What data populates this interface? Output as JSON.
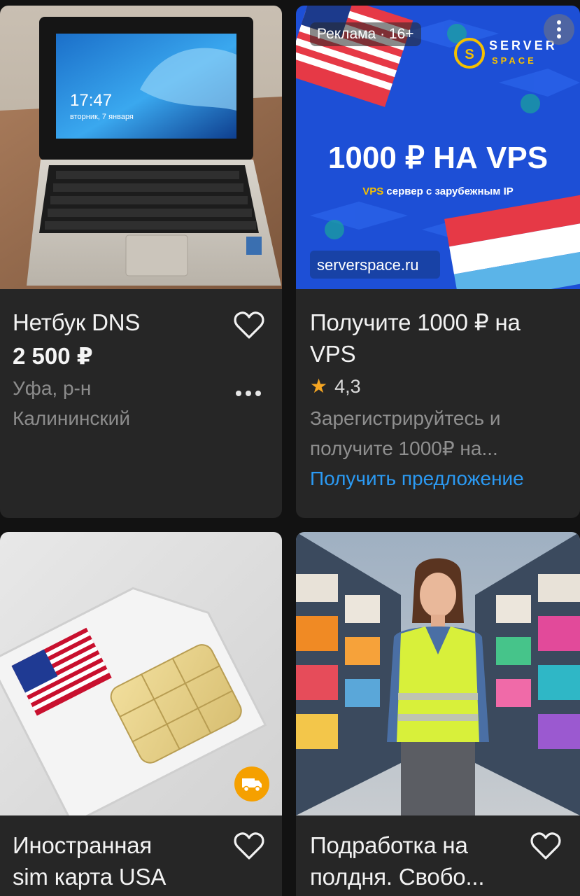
{
  "cards": {
    "netbook": {
      "title": "Нетбук DNS",
      "price": "2 500 ₽",
      "location_line1": "Уфа, р-н",
      "location_line2": "Калининский",
      "screen_time": "17:47",
      "screen_date": "вторник, 7 января",
      "image_icon": "laptop-photo"
    },
    "ad": {
      "badge": "Реклама · 16+",
      "brand_line1": "SERVER",
      "brand_line2": "SPACE",
      "headline": "1000 ₽ НА VPS",
      "sub_highlight": "VPS",
      "sub_rest": " сервер с зарубежным IP",
      "domain": "serverspace.ru",
      "title_line1": "Получите 1000 ₽ на",
      "title_line2": "VPS",
      "rating": "4,3",
      "desc_line1": "Зарегистрируйтесь и",
      "desc_line2": "получите 1000₽ на...",
      "cta": "Получить предложение",
      "accent_color": "#2b9af3",
      "banner_color": "#1d4fd6"
    },
    "sim": {
      "title_line1": "Иностранная",
      "title_line2": "sim карта USA",
      "image_icon": "sim-card-photo",
      "badge_icon": "delivery-truck-icon"
    },
    "job": {
      "title_line1": "Подработка на",
      "title_line2": "полдня. Свобо...",
      "image_icon": "warehouse-worker-photo"
    }
  }
}
